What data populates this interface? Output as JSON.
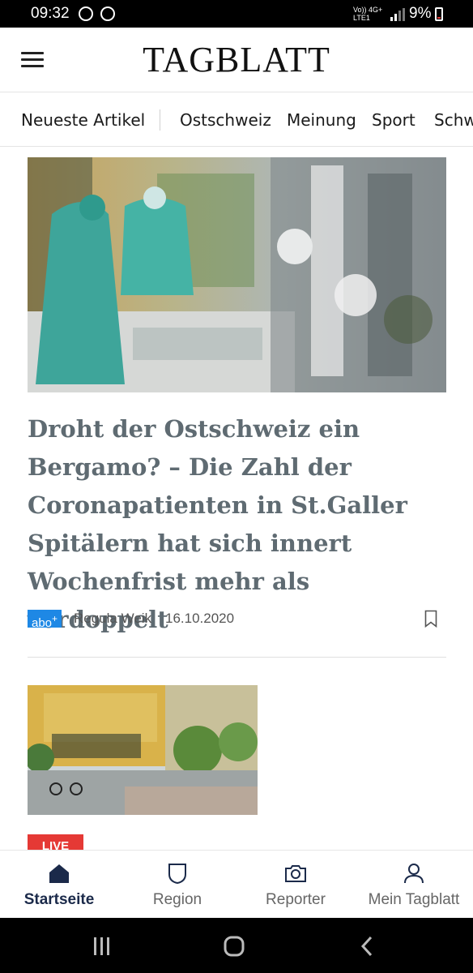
{
  "status_bar": {
    "time": "09:32",
    "network_line1": "Vo)) 4G+",
    "network_line2": "LTE1",
    "battery": "9%",
    "icons": [
      "whatsapp-icon",
      "signal-app-icon",
      "cell-signal-icon",
      "battery-icon"
    ]
  },
  "header": {
    "logo": "TAGBLATT",
    "menu_icon": "hamburger-menu-icon"
  },
  "nav": {
    "items": [
      {
        "label": "Neueste Artikel"
      },
      {
        "label": "Ostschweiz"
      },
      {
        "label": "Meinung"
      },
      {
        "label": "Sport"
      },
      {
        "label": "Schw"
      }
    ]
  },
  "articles": [
    {
      "image_alt": "Intensivstation mit Pflegepersonal in Schutzkleidung",
      "headline": "Droht der Ostschweiz ein Bergamo? – Die Zahl der Coronapatienten in St.Galler Spitälern hat sich innert Wochenfrist mehr als verdoppelt",
      "badge": "abo",
      "badge_sup": "+",
      "author": "Regula Weik",
      "date": "16.10.2020"
    },
    {
      "image_alt": "Platz vor Gebäude mit Markthaus",
      "badge": "LIVE"
    }
  ],
  "tabbar": {
    "tabs": [
      {
        "label": "Startseite",
        "icon": "home-icon",
        "active": true
      },
      {
        "label": "Region",
        "icon": "shield-icon",
        "active": false
      },
      {
        "label": "Reporter",
        "icon": "camera-icon",
        "active": false
      },
      {
        "label": "Mein Tagblatt",
        "icon": "user-icon",
        "active": false
      }
    ]
  },
  "colors": {
    "headline": "#5f6b72",
    "abo_badge": "#1e88e5",
    "live_badge": "#e53935",
    "active_tab": "#1b2a4a"
  }
}
